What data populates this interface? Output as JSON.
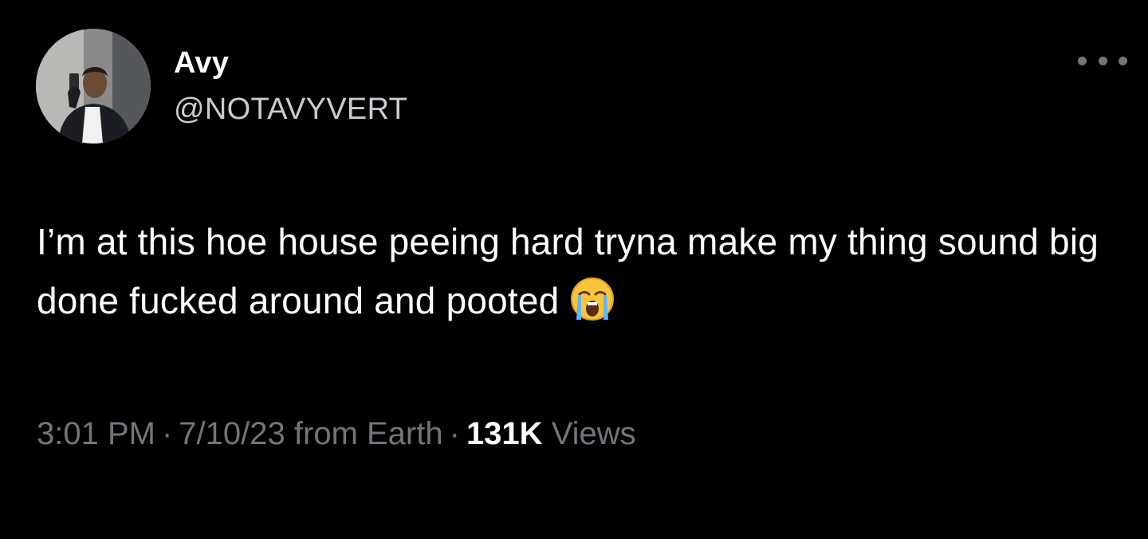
{
  "tweet": {
    "author": {
      "display_name": "Avy",
      "handle": "@NOTAVYVERT"
    },
    "text": "I’m at this hoe house peeing hard tryna make my thing sound big done fucked around and pooted",
    "emoji": "loudly-crying-face",
    "meta": {
      "time": "3:01 PM",
      "date": "7/10/23",
      "source": "from Earth",
      "separator": "·",
      "views_count": "131K",
      "views_label": "Views"
    }
  },
  "colors": {
    "background": "#000000",
    "primary_text": "#ffffff",
    "secondary_text": "#71767b"
  },
  "icons": {
    "more": "more-horizontal-icon"
  }
}
